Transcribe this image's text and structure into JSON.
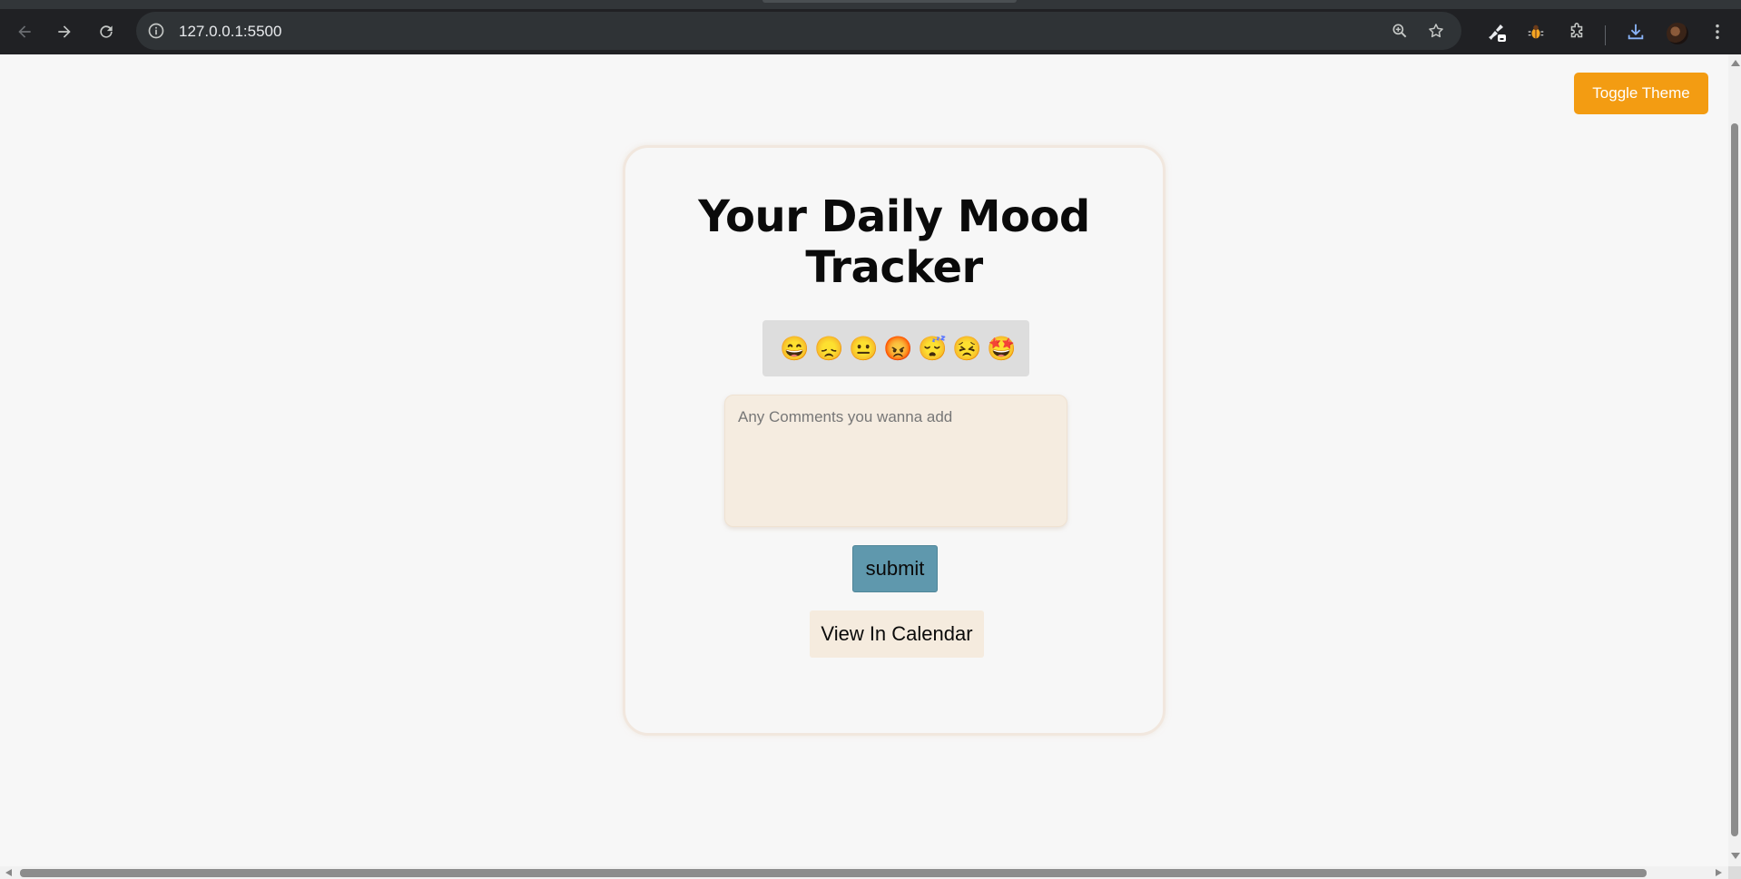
{
  "browser": {
    "url": "127.0.0.1:5500"
  },
  "page": {
    "theme_button": "Toggle Theme",
    "title": "Your Daily Mood Tracker",
    "moods": [
      "😄",
      "😞",
      "😐",
      "😡",
      "😴",
      "😣",
      "🤩"
    ],
    "comment_placeholder": "Any Comments you wanna add",
    "submit_label": "submit",
    "calendar_label": "View In Calendar"
  },
  "colors": {
    "accent": "#f39c12",
    "submit": "#5f98ad",
    "card_border": "#f1e7de",
    "textarea_bg": "#f5ece0"
  }
}
